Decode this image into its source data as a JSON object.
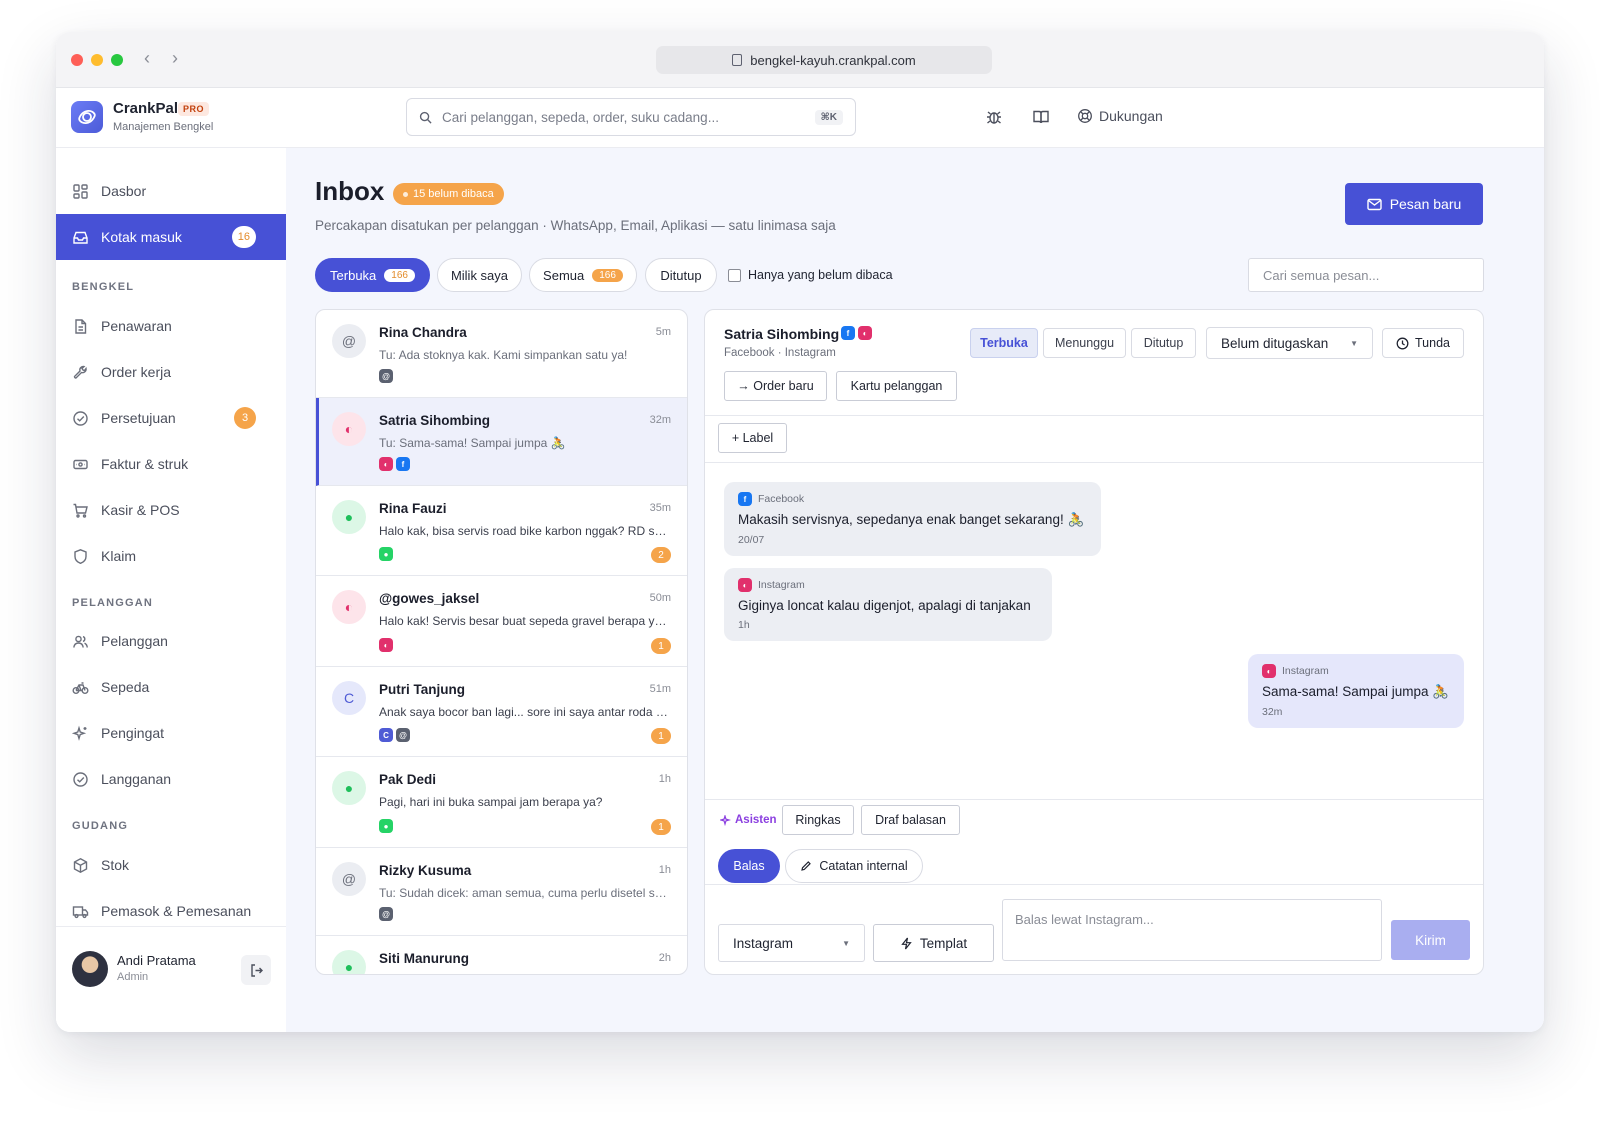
{
  "browser": {
    "url": "bengkel-kayuh.crankpal.com"
  },
  "brand": {
    "name": "CrankPal",
    "badge": "PRO",
    "subtitle": "Manajemen Bengkel"
  },
  "header": {
    "search_placeholder": "Cari pelanggan, sepeda, order, suku cadang...",
    "search_shortcut": "⌘K",
    "support_label": "Dukungan"
  },
  "sidebar": {
    "top": [
      {
        "label": "Dasbor",
        "icon": "grid-icon"
      },
      {
        "label": "Kotak masuk",
        "icon": "inbox-icon",
        "badge": "16",
        "active": true
      }
    ],
    "sections": [
      {
        "title": "BENGKEL",
        "items": [
          {
            "label": "Penawaran",
            "icon": "document-icon"
          },
          {
            "label": "Order kerja",
            "icon": "wrench-icon"
          },
          {
            "label": "Persetujuan",
            "icon": "check-circle-icon",
            "badge": "3"
          },
          {
            "label": "Faktur & struk",
            "icon": "receipt-icon"
          },
          {
            "label": "Kasir & POS",
            "icon": "cart-icon"
          },
          {
            "label": "Klaim",
            "icon": "shield-icon"
          }
        ]
      },
      {
        "title": "PELANGGAN",
        "items": [
          {
            "label": "Pelanggan",
            "icon": "users-icon"
          },
          {
            "label": "Sepeda",
            "icon": "bike-icon"
          },
          {
            "label": "Pengingat",
            "icon": "sparkle-icon"
          },
          {
            "label": "Langganan",
            "icon": "check-circle-icon"
          }
        ]
      },
      {
        "title": "GUDANG",
        "items": [
          {
            "label": "Stok",
            "icon": "box-icon"
          },
          {
            "label": "Pemasok & Pemesanan",
            "icon": "truck-icon"
          }
        ]
      }
    ],
    "user": {
      "name": "Andi Pratama",
      "role": "Admin"
    }
  },
  "page": {
    "title": "Inbox",
    "unread_label": "15 belum dibaca",
    "subtitle": "Percakapan disatukan per pelanggan · WhatsApp, Email, Aplikasi — satu linimasa saja",
    "new_message_label": "Pesan baru",
    "filters": [
      {
        "label": "Terbuka",
        "count": "166",
        "active": true
      },
      {
        "label": "Milik saya"
      },
      {
        "label": "Semua",
        "count": "166"
      },
      {
        "label": "Ditutup"
      }
    ],
    "unread_only_label": "Hanya yang belum dibaca",
    "search_all_placeholder": "Cari semua pesan..."
  },
  "colors": {
    "accent": "#4751d6",
    "badge_orange": "#f5a44a",
    "facebook": "#1877f2",
    "instagram": "#e1306c",
    "whatsapp": "#25d366",
    "email": "#5b6170",
    "app": "#4f5bd5"
  },
  "conversations": [
    {
      "name": "Rina Chandra",
      "time": "5m",
      "snippet": "Tu: Ada stoknya kak. Kami simpankan satu ya!",
      "avatar": "@",
      "avatar_type": "email",
      "channels": [
        "email"
      ],
      "unread": ""
    },
    {
      "name": "Satria Sihombing",
      "time": "32m",
      "snippet": "Tu: Sama-sama! Sampai jumpa 🚴",
      "avatar": "◐",
      "avatar_type": "instagram",
      "channels": [
        "instagram",
        "facebook"
      ],
      "unread": "",
      "selected": true
    },
    {
      "name": "Rina Fauzi",
      "time": "35m",
      "snippet": "Halo kak, bisa servis road bike karbon nggak? RD sepertinya bengkok",
      "avatar": "●",
      "avatar_type": "whatsapp",
      "channels": [
        "whatsapp"
      ],
      "unread": "2"
    },
    {
      "name": "@gowes_jaksel",
      "time": "50m",
      "snippet": "Halo kak! Servis besar buat sepeda gravel berapa ya kak?",
      "avatar": "◐",
      "avatar_type": "instagram",
      "channels": [
        "instagram"
      ],
      "unread": "1"
    },
    {
      "name": "Putri Tanjung",
      "time": "51m",
      "snippet": "Anak saya bocor ban lagi... sore ini saya antar roda belakangnya",
      "avatar": "C",
      "avatar_type": "app",
      "channels": [
        "app",
        "email"
      ],
      "unread": "1"
    },
    {
      "name": "Pak Dedi",
      "time": "1h",
      "snippet": "Pagi, hari ini buka sampai jam berapa ya?",
      "avatar": "●",
      "avatar_type": "whatsapp",
      "channels": [
        "whatsapp"
      ],
      "unread": "1"
    },
    {
      "name": "Rizky Kusuma",
      "time": "1h",
      "snippet": "Tu: Sudah dicek: aman semua, cuma perlu disetel sedikit",
      "avatar": "@",
      "avatar_type": "email",
      "channels": [
        "email"
      ],
      "unread": ""
    },
    {
      "name": "Siti Manurung",
      "time": "2h",
      "snippet": "",
      "avatar": "●",
      "avatar_type": "whatsapp",
      "channels": [],
      "unread": ""
    }
  ],
  "thread": {
    "name": "Satria Sihombing",
    "sources": "Facebook · Instagram",
    "status_buttons": [
      "Terbuka",
      "Menunggu",
      "Ditutup"
    ],
    "active_status": "Terbuka",
    "assignee": "Belum ditugaskan",
    "snooze_label": "Tunda",
    "actions": {
      "new_order": "→ Order baru",
      "customer_card": "Kartu pelanggan",
      "add_label": "+ Label"
    },
    "messages": [
      {
        "channel": "Facebook",
        "channel_type": "facebook",
        "text": "Makasih servisnya, sepedanya enak banget sekarang! 🚴",
        "time": "20/07",
        "direction": "in"
      },
      {
        "channel": "Instagram",
        "channel_type": "instagram",
        "text": "Giginya loncat kalau digenjot, apalagi di tanjakan",
        "time": "1h",
        "direction": "in"
      },
      {
        "channel": "Instagram",
        "channel_type": "instagram",
        "text": "Sama-sama! Sampai jumpa 🚴",
        "time": "32m",
        "direction": "out"
      }
    ],
    "assistant": {
      "label": "Asisten",
      "summarize": "Ringkas",
      "draft": "Draf balasan"
    },
    "compose": {
      "reply_tab": "Balas",
      "note_tab": "Catatan internal",
      "channel": "Instagram",
      "template_label": "Templat",
      "placeholder": "Balas lewat Instagram...",
      "send_label": "Kirim"
    }
  }
}
